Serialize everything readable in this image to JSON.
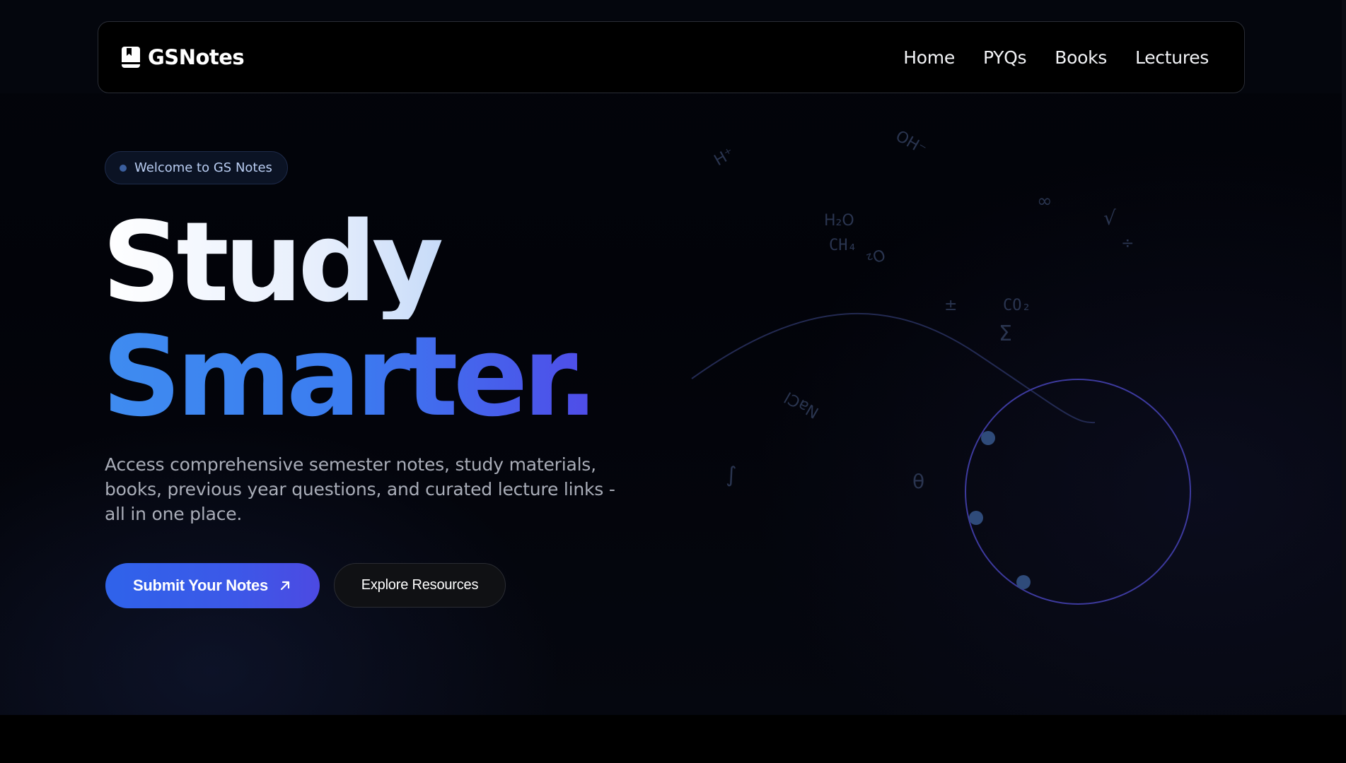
{
  "brand": {
    "name": "GSNotes",
    "icon": "book-bookmark-icon"
  },
  "nav": {
    "links": [
      "Home",
      "PYQs",
      "Books",
      "Lectures"
    ]
  },
  "hero": {
    "badge": "Welcome to GS Notes",
    "headline_line1": "Study",
    "headline_line2": "Smarter.",
    "description": "Access comprehensive semester notes, study materials, books, previous year questions, and curated lecture links - all in one place.",
    "primary_button": "Submit Your Notes",
    "primary_button_icon": "arrow-up-right-icon",
    "secondary_button": "Explore Resources"
  },
  "decorations": {
    "symbols": [
      "H⁺",
      "OH⁻",
      "H₂O",
      "O₂",
      "CH₄",
      "∞",
      "√",
      "÷",
      "±",
      "CO₂",
      "Σ",
      "NaCl",
      "∫",
      "θ"
    ]
  },
  "colors": {
    "accent_blue": "#3b7cf0",
    "accent_indigo": "#4f4ce8",
    "background": "#000000",
    "orbit_stroke": "#3d3a9e",
    "orbit_dot": "#2f4b7a"
  }
}
